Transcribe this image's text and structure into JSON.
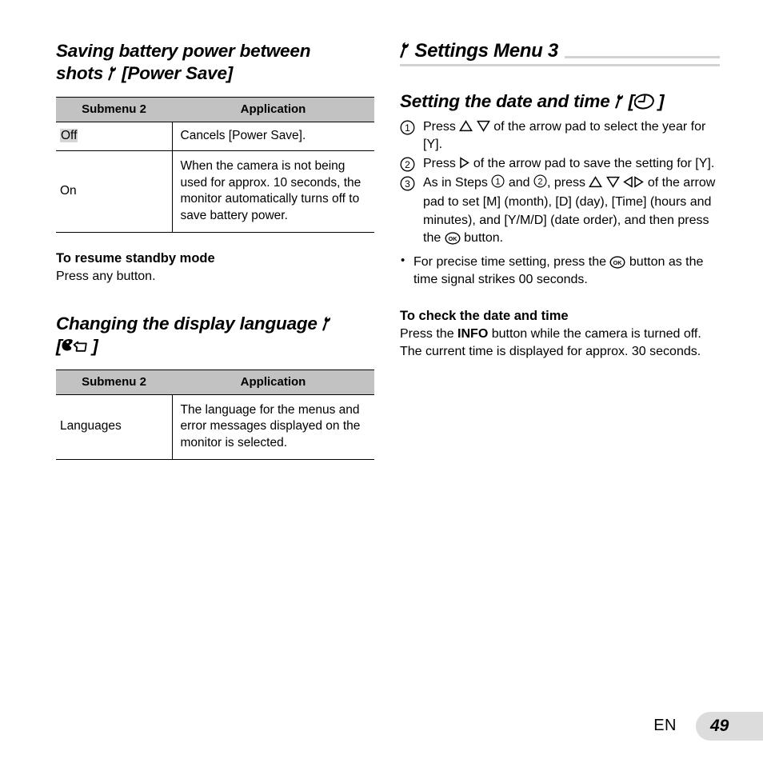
{
  "left_column": {
    "section1": {
      "title_line1": "Saving battery power between",
      "title_line2_pre": "shots",
      "title_line2_post": "[Power Save]",
      "wrench_icon": "wrench-icon",
      "table": {
        "headers": [
          "Submenu 2",
          "Application"
        ],
        "rows": [
          {
            "submenu": "Off",
            "highlighted": true,
            "application": "Cancels [Power Save]."
          },
          {
            "submenu": "On",
            "highlighted": false,
            "application": "When the camera is not being used for approx. 10 seconds, the monitor automatically turns off to save battery power."
          }
        ]
      },
      "subsection": {
        "heading": "To resume standby mode",
        "body": "Press any button."
      }
    },
    "section2": {
      "title_line1_pre": "Changing the display language",
      "title_line2_pre": "[",
      "title_line2_post": "]",
      "wrench_icon": "wrench-icon",
      "language_icon": "language-head-speech-icon",
      "table": {
        "headers": [
          "Submenu 2",
          "Application"
        ],
        "rows": [
          {
            "submenu": "Languages",
            "highlighted": false,
            "application": "The language for the menus and error messages displayed on the monitor is selected."
          }
        ]
      }
    }
  },
  "right_column": {
    "banner": {
      "title": "Settings Menu 3",
      "wrench_icon": "wrench-icon",
      "rule_color": "#d2d2d2"
    },
    "section1": {
      "title_pre": "Setting the date and time",
      "title_bracket_open": "[",
      "title_bracket_close": "]",
      "wrench_icon": "wrench-icon",
      "clock_icon": "clock-icon",
      "steps": [
        {
          "number": "1",
          "text_a": "Press",
          "arrows": [
            "up",
            "down"
          ],
          "text_b": "of the arrow pad to select the year for [Y]."
        },
        {
          "number": "2",
          "text_a": "Press",
          "arrows": [
            "right"
          ],
          "text_b": "of the arrow pad to save the setting for [Y]."
        },
        {
          "number": "3",
          "text_a": "As in Steps",
          "ref1": "1",
          "text_and": "and",
          "ref2": "2",
          "text_press": ", press",
          "arrows": [
            "up",
            "down",
            "left",
            "right"
          ],
          "text_b": "of the arrow pad to set [M] (month), [D] (day), [Time] (hours and minutes), and [Y/M/D] (date order), and then press the",
          "ok_icon": "ok-button-icon",
          "text_c": "button."
        }
      ],
      "bullets": [
        {
          "text_a": "For precise time setting, press the",
          "ok_icon": "ok-button-icon",
          "text_b": "button as the time signal strikes 00 seconds."
        }
      ]
    },
    "section2": {
      "heading": "To check the date and time",
      "body_a": "Press the",
      "body_keyword": "INFO",
      "body_b": "button while the camera is turned off. The current time is displayed for approx. 30 seconds."
    }
  },
  "footer": {
    "language_code": "EN",
    "page_number": "49",
    "box_color": "#dcdcdc"
  }
}
